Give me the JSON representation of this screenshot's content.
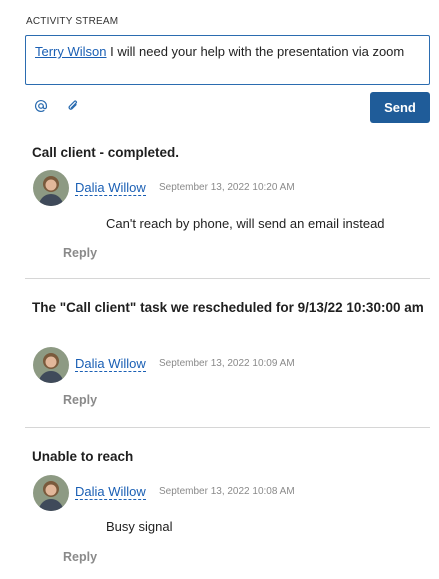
{
  "section": {
    "label": "ACTIVITY STREAM"
  },
  "composer": {
    "mention": "Terry Wilson",
    "text": " I will need your help with the presentation via zoom"
  },
  "toolbar": {
    "mention_icon": "at-icon",
    "attach_icon": "paperclip-icon",
    "send_label": "Send"
  },
  "colors": {
    "accent": "#1f5c99",
    "link": "#1a5fb4",
    "muted": "#8a8a8a"
  },
  "entries": [
    {
      "title": "Call client - completed.",
      "author": "Dalia Willow",
      "timestamp": "September 13, 2022 10:20 AM",
      "comment": "Can't reach by phone, will send an email instead",
      "reply": "Reply"
    },
    {
      "title": "The \"Call client\" task we rescheduled for 9/13/22 10:30:00 am",
      "author": "Dalia Willow",
      "timestamp": "September 13, 2022 10:09 AM",
      "comment": "",
      "reply": "Reply"
    },
    {
      "title": "Unable to reach",
      "author": "Dalia Willow",
      "timestamp": "September 13, 2022 10:08 AM",
      "comment": "Busy signal",
      "reply": "Reply"
    }
  ]
}
